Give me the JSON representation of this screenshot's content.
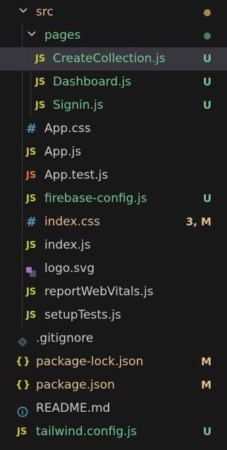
{
  "explorer": {
    "colors": {
      "untracked": "#73c991",
      "modified": "#e2c08d",
      "folder_dot_src": "#a58a48",
      "folder_dot_pages": "#4f7f55",
      "js_icon": "#cbcb41",
      "test_icon": "#e37933",
      "css_icon": "#519aba",
      "svg_icon": "#a074c4",
      "selection": "#37373d"
    },
    "folders": {
      "src": {
        "label": "src",
        "expanded": true
      },
      "pages": {
        "label": "pages",
        "expanded": true
      }
    },
    "files": {
      "create_collection": {
        "icon": "JS",
        "label": "CreateCollection.js",
        "badge": "U"
      },
      "dashboard": {
        "icon": "JS",
        "label": "Dashboard.js",
        "badge": "U"
      },
      "signin": {
        "icon": "JS",
        "label": "Signin.js",
        "badge": "U"
      },
      "app_css": {
        "icon": "#",
        "label": "App.css"
      },
      "app_js": {
        "icon": "JS",
        "label": "App.js"
      },
      "app_test": {
        "icon": "JS",
        "label": "App.test.js"
      },
      "firebase_config": {
        "icon": "JS",
        "label": "firebase-config.js",
        "badge": "U"
      },
      "index_css": {
        "icon": "#",
        "label": "index.css",
        "badge": "3, M"
      },
      "index_js": {
        "icon": "JS",
        "label": "index.js"
      },
      "logo_svg": {
        "icon": "svg-icon",
        "label": "logo.svg"
      },
      "report_web_vitals": {
        "icon": "JS",
        "label": "reportWebVitals.js"
      },
      "setup_tests": {
        "icon": "JS",
        "label": "setupTests.js"
      },
      "gitignore": {
        "icon": "git-icon",
        "label": ".gitignore"
      },
      "package_lock": {
        "icon": "{}",
        "label": "package-lock.json",
        "badge": "M"
      },
      "package_json": {
        "icon": "{}",
        "label": "package.json",
        "badge": "M"
      },
      "readme": {
        "icon": "info-icon",
        "label": "README.md"
      },
      "tailwind_config": {
        "icon": "JS",
        "label": "tailwind.config.js",
        "badge": "U"
      }
    }
  }
}
